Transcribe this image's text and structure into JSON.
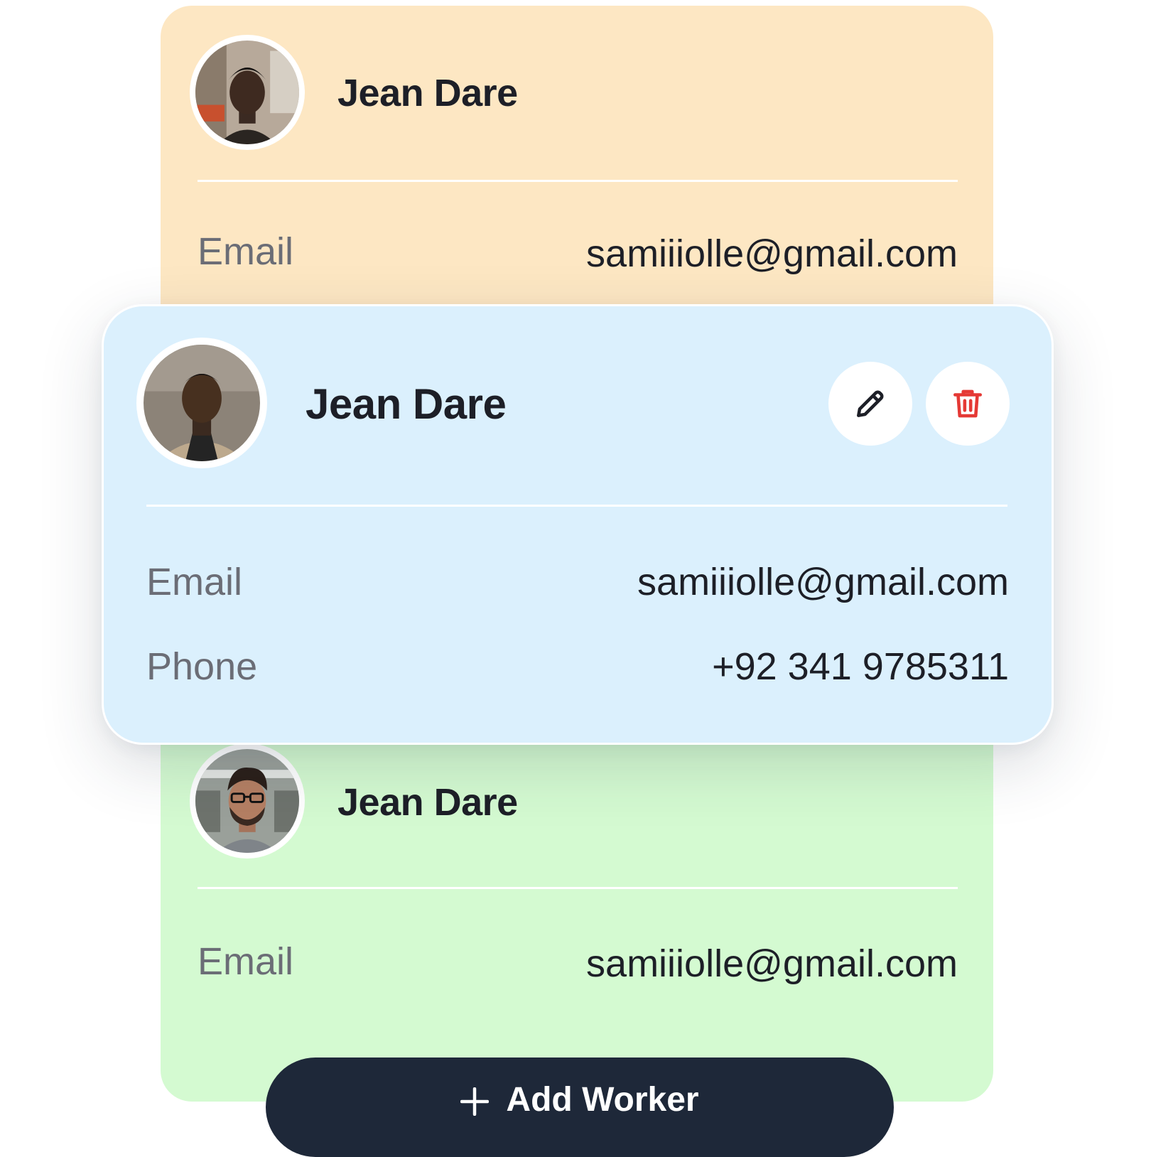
{
  "cards": [
    {
      "id": "orange",
      "name": "Jean Dare",
      "fields": [
        {
          "label": "Email",
          "value": "samiiiolle@gmail.com"
        }
      ],
      "background": "#fde7c3"
    },
    {
      "id": "blue",
      "name": "Jean Dare",
      "fields": [
        {
          "label": "Email",
          "value": "samiiiolle@gmail.com"
        },
        {
          "label": "Phone",
          "value": "+92 341 9785311"
        }
      ],
      "actions": [
        {
          "icon": "pencil-icon"
        },
        {
          "icon": "trash-icon",
          "color": "#e53935"
        }
      ],
      "background": "#dbf0fd"
    },
    {
      "id": "green",
      "name": "Jean Dare",
      "fields": [
        {
          "label": "Email",
          "value": "samiiiolle@gmail.com"
        }
      ],
      "background": "#d4fad1"
    }
  ],
  "add_button": {
    "label": "Add Worker",
    "icon": "plus-icon",
    "background": "#1e2839"
  }
}
